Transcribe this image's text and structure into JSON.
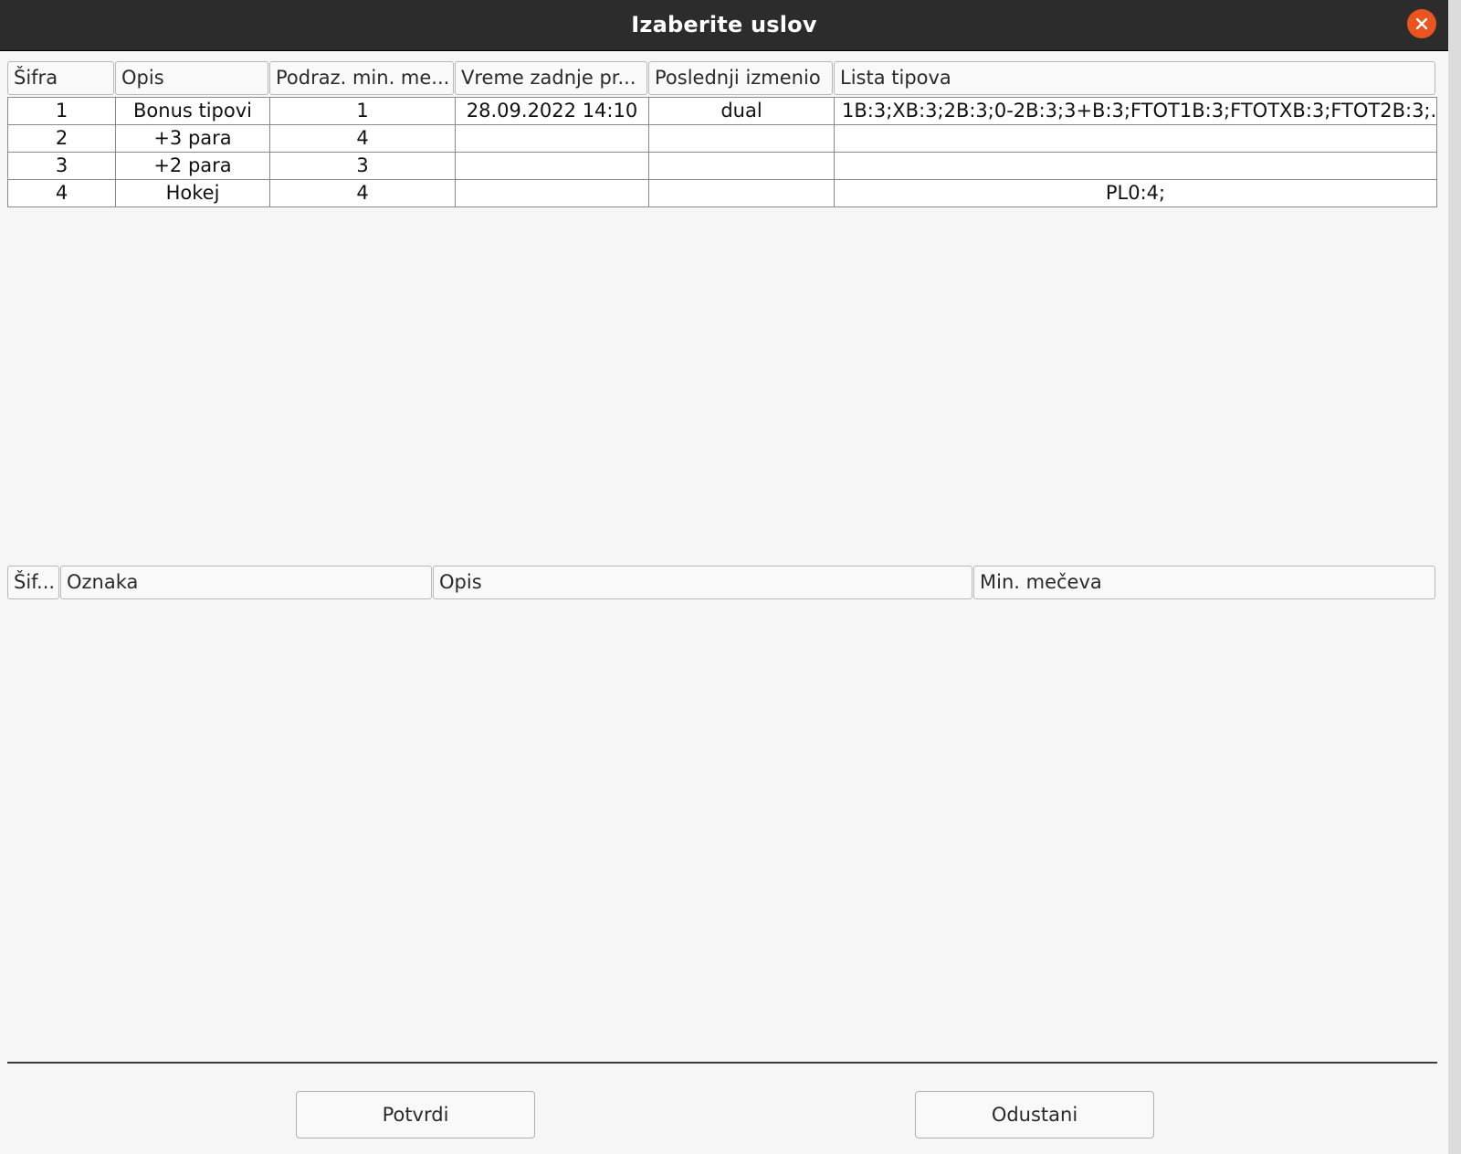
{
  "window": {
    "title": "Izaberite uslov"
  },
  "conditions_table": {
    "headers": [
      "Šifra",
      "Opis",
      "Podraz. min. me...",
      "Vreme zadnje pr...",
      "Poslednji izmenio",
      "Lista tipova"
    ],
    "rows": [
      [
        "1",
        "Bonus tipovi",
        "1",
        "28.09.2022 14:10",
        "dual",
        "1B:3;XB:3;2B:3;0-2B:3;3+B:3;FTOT1B:3;FTOTXB:3;FTOT2B:3;..."
      ],
      [
        "2",
        "+3 para",
        "4",
        "",
        "",
        ""
      ],
      [
        "3",
        "+2 para",
        "3",
        "",
        "",
        ""
      ],
      [
        "4",
        "Hokej",
        "4",
        "",
        "",
        "PL0:4;"
      ]
    ]
  },
  "details_table": {
    "headers": [
      "Šif...",
      "Oznaka",
      "Opis",
      "Min. mečeva"
    ]
  },
  "buttons": {
    "confirm": "Potvrdi",
    "cancel": "Odustani"
  },
  "colors": {
    "titlebar": "#2c2c2c",
    "close_button": "#e9541f",
    "background": "#f6f6f6"
  }
}
